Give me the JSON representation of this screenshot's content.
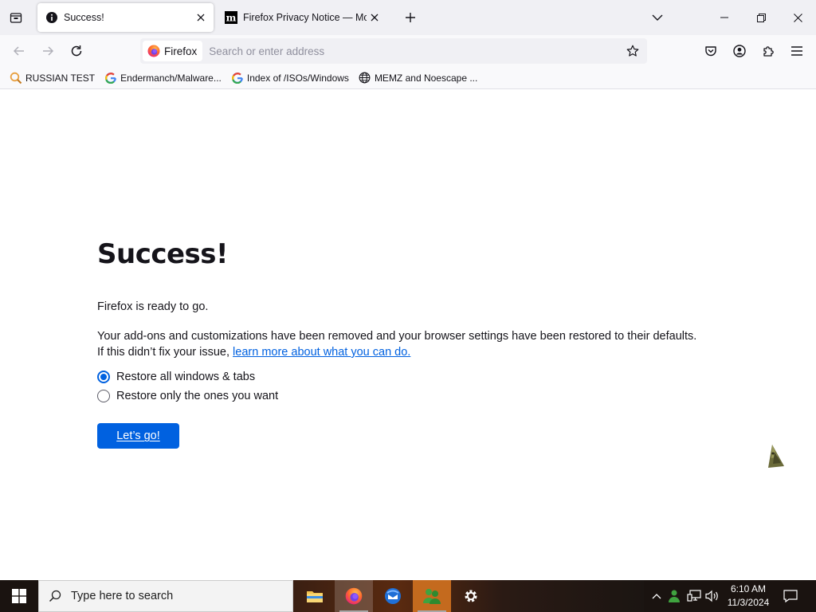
{
  "browser": {
    "tabs": [
      {
        "title": "Success!",
        "active": true,
        "favicon": "info-icon"
      },
      {
        "title": "Firefox Privacy Notice — Mozill",
        "active": false,
        "favicon": "mozilla-m-icon"
      }
    ],
    "urlbar": {
      "identity_label": "Firefox",
      "placeholder": "Search or enter address"
    },
    "bookmarks": [
      {
        "label": "RUSSIAN TEST",
        "icon": "search-magnifier-icon"
      },
      {
        "label": "Endermanch/Malware...",
        "icon": "google-icon"
      },
      {
        "label": "Index of /ISOs/Windows",
        "icon": "google-icon"
      },
      {
        "label": "MEMZ and Noescape ...",
        "icon": "globe-icon"
      }
    ]
  },
  "page": {
    "heading": "Success!",
    "ready_text": "Firefox is ready to go.",
    "description_line1": "Your add-ons and customizations have been removed and your browser settings have been restored to their defaults.",
    "description_line2_prefix": "If this didn’t fix your issue, ",
    "learn_more_link": "learn more about what you can do.",
    "options": [
      {
        "label": "Restore all windows & tabs",
        "checked": true
      },
      {
        "label": "Restore only the ones you want",
        "checked": false
      }
    ],
    "button_label": "Let’s go!"
  },
  "taskbar": {
    "search_placeholder": "Type here to search",
    "time": "6:10 AM",
    "date": "11/3/2024"
  },
  "colors": {
    "accent": "#0061e0",
    "tabstrip": "#f0f0f4",
    "taskbar": "#1a1310"
  }
}
